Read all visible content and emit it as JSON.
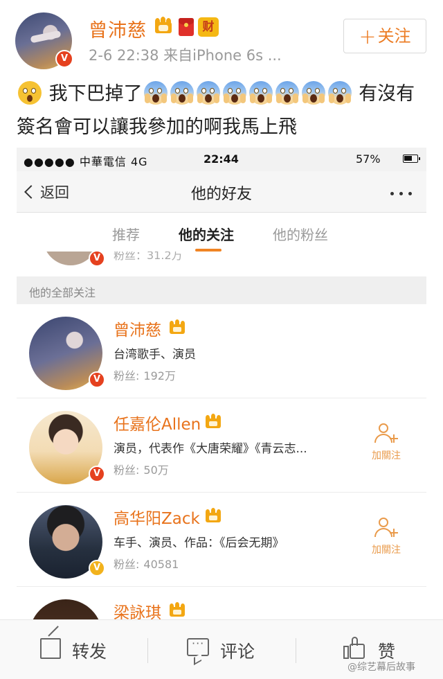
{
  "post": {
    "author_name": "曾沛慈",
    "cai_badge": "财",
    "meta": "2-6 22:38  来自iPhone 6s ...",
    "follow_label": "关注",
    "text_part1": "我下巴掉了",
    "text_part2": "有沒有簽名會可以讓我參加的啊我馬上飛",
    "verified_mark": "V"
  },
  "phone": {
    "status": {
      "signal": "●●●●● 中華電信  4G",
      "time": "22:44",
      "battery": "57%"
    },
    "nav": {
      "back_label": "返回",
      "title": "他的好友"
    },
    "tabs": [
      {
        "label": "推荐",
        "active": false
      },
      {
        "label": "他的关注",
        "active": true
      },
      {
        "label": "他的粉丝",
        "active": false
      }
    ],
    "prev_row_fans": "粉丝：31.2万",
    "section_label": "他的全部关注",
    "users": [
      {
        "name": "曾沛慈",
        "desc": "台湾歌手、演员",
        "fans_label": "粉丝:",
        "fans": "192万",
        "badge": "V",
        "badge_color": "#e5411f",
        "show_add": false
      },
      {
        "name": "任嘉伦Allen",
        "desc": "演员，代表作《大唐荣耀》《青云志...",
        "fans_label": "粉丝:",
        "fans": "50万",
        "badge": "V",
        "badge_color": "#e5411f",
        "show_add": true
      },
      {
        "name": "高华阳Zack",
        "desc": "车手、演员、作品：《后会无期》",
        "fans_label": "粉丝:",
        "fans": "40581",
        "badge": "V",
        "badge_color": "#f2b21c",
        "show_add": true
      },
      {
        "name": "梁詠琪",
        "desc": "",
        "fans_label": "",
        "fans": "",
        "badge": "",
        "badge_color": "#e5411f",
        "show_add": false
      }
    ],
    "add_follow_label": "加關注"
  },
  "actions": {
    "share": "转发",
    "comment": "评论",
    "like": "赞"
  },
  "watermark": "@综艺幕后故事",
  "colors": {
    "accent_orange": "#e8731c",
    "verified_red": "#e5411f",
    "verified_gold": "#f2b21c"
  }
}
